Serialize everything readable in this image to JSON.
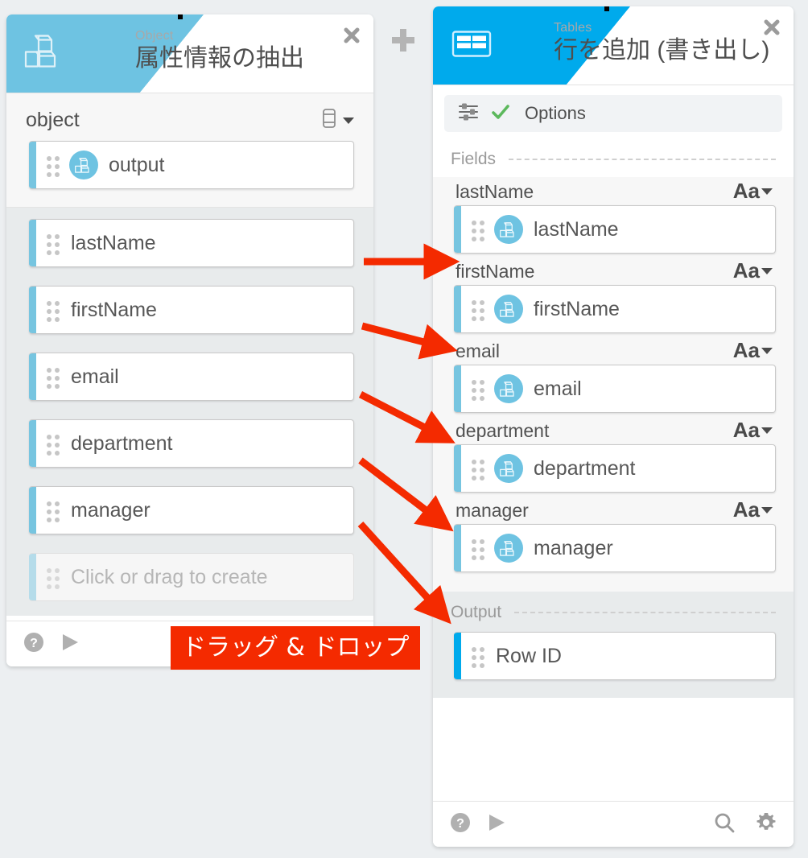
{
  "colors": {
    "object_accent": "#6ec3e2",
    "tables_accent": "#00aaec",
    "annotation_red": "#f42a00",
    "check_green": "#5cb85c",
    "page_background": "#eceff1"
  },
  "canvas": {
    "add_button_icon": "plus-icon"
  },
  "object_panel": {
    "header": {
      "kicker": "Object",
      "title": "属性情報の抽出",
      "icon": "cubes-icon",
      "close_icon": "close-icon"
    },
    "object_section": {
      "label": "object",
      "selector_icon": "database-icon",
      "selector_caret_icon": "caret-down-icon",
      "slot": {
        "label": "output",
        "icon": "cubes-icon",
        "grip_icon": "drag-grip-icon"
      }
    },
    "fields": [
      {
        "label": "lastName",
        "grip_icon": "drag-grip-icon"
      },
      {
        "label": "firstName",
        "grip_icon": "drag-grip-icon"
      },
      {
        "label": "email",
        "grip_icon": "drag-grip-icon"
      },
      {
        "label": "department",
        "grip_icon": "drag-grip-icon"
      },
      {
        "label": "manager",
        "grip_icon": "drag-grip-icon"
      }
    ],
    "placeholder_slot": {
      "label": "Click or drag to create",
      "grip_icon": "drag-grip-icon"
    },
    "footer": {
      "help_icon": "help-circle-icon",
      "run_icon": "play-icon"
    }
  },
  "tables_panel": {
    "header": {
      "kicker": "Tables",
      "title": "行を追加 (書き出し)",
      "icon": "table-grid-icon",
      "close_icon": "close-icon"
    },
    "options_row": {
      "label": "Options",
      "icon": "sliders-icon",
      "status_icon": "check-icon"
    },
    "fields_section": {
      "label": "Fields"
    },
    "fields": [
      {
        "name": "lastName",
        "type_label": "Aa",
        "type_icon": "type-text-icon",
        "caret_icon": "caret-down-icon",
        "slot_label": "lastName",
        "slot_icon": "cubes-icon",
        "grip_icon": "drag-grip-icon"
      },
      {
        "name": "firstName",
        "type_label": "Aa",
        "type_icon": "type-text-icon",
        "caret_icon": "caret-down-icon",
        "slot_label": "firstName",
        "slot_icon": "cubes-icon",
        "grip_icon": "drag-grip-icon"
      },
      {
        "name": "email",
        "type_label": "Aa",
        "type_icon": "type-text-icon",
        "caret_icon": "caret-down-icon",
        "slot_label": "email",
        "slot_icon": "cubes-icon",
        "grip_icon": "drag-grip-icon"
      },
      {
        "name": "department",
        "type_label": "Aa",
        "type_icon": "type-text-icon",
        "caret_icon": "caret-down-icon",
        "slot_label": "department",
        "slot_icon": "cubes-icon",
        "grip_icon": "drag-grip-icon"
      },
      {
        "name": "manager",
        "type_label": "Aa",
        "type_icon": "type-text-icon",
        "caret_icon": "caret-down-icon",
        "slot_label": "manager",
        "slot_icon": "cubes-icon",
        "grip_icon": "drag-grip-icon"
      }
    ],
    "output_section": {
      "label": "Output",
      "slot": {
        "label": "Row ID",
        "grip_icon": "drag-grip-icon"
      }
    },
    "footer": {
      "help_icon": "help-circle-icon",
      "run_icon": "play-icon",
      "search_icon": "search-icon",
      "settings_icon": "gear-icon"
    }
  },
  "annotation": {
    "banner_text": "ドラッグ & ドロップ",
    "arrow_count": 5,
    "arrow_icon": "red-arrow-icon"
  }
}
